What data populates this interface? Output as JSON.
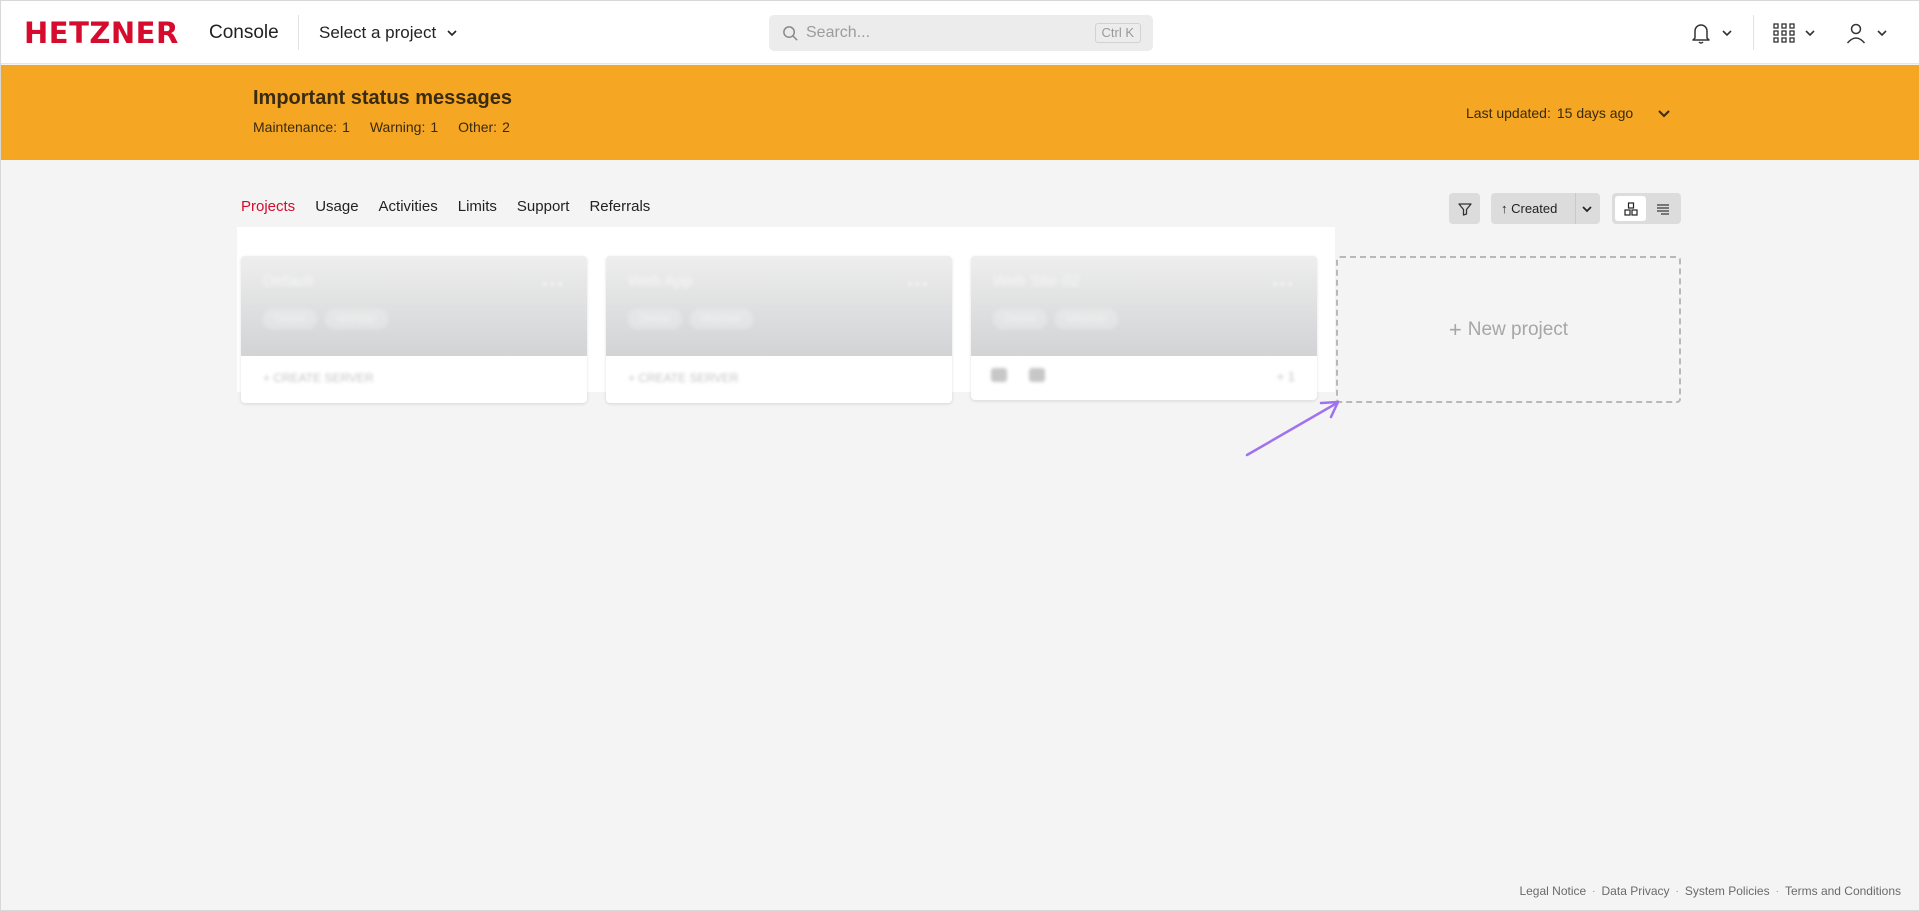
{
  "header": {
    "logo": "HETZNER",
    "product": "Console",
    "project_select": "Select a project",
    "search_placeholder": "Search...",
    "search_shortcut": "Ctrl K"
  },
  "banner": {
    "title": "Important status messages",
    "counts": [
      {
        "label": "Maintenance:",
        "value": "1"
      },
      {
        "label": "Warning:",
        "value": "1"
      },
      {
        "label": "Other:",
        "value": "2"
      }
    ],
    "last_updated_label": "Last updated:",
    "last_updated_value": "15 days ago",
    "color": "#f5a623"
  },
  "tabs": [
    {
      "label": "Projects",
      "active": true
    },
    {
      "label": "Usage"
    },
    {
      "label": "Activities"
    },
    {
      "label": "Limits"
    },
    {
      "label": "Support"
    },
    {
      "label": "Referrals"
    }
  ],
  "toolbar": {
    "sort_label": "↑ Created"
  },
  "projects": [
    {
      "name": "Default",
      "tags": [
        "Owner",
        "Member"
      ],
      "footer": "+ CREATE SERVER"
    },
    {
      "name": "Web App",
      "tags": [
        "Owner",
        "Member"
      ],
      "footer": "+ CREATE SERVER"
    },
    {
      "name": "Web Site 02",
      "tags": [
        "Owner",
        "Member"
      ],
      "footer_count": "+ 1"
    }
  ],
  "new_project_label": "New project",
  "footer": [
    "Legal Notice",
    "Data Privacy",
    "System Policies",
    "Terms and Conditions"
  ],
  "colors": {
    "brand": "#d50c2d",
    "annotation_arrow": "#a071f0"
  }
}
